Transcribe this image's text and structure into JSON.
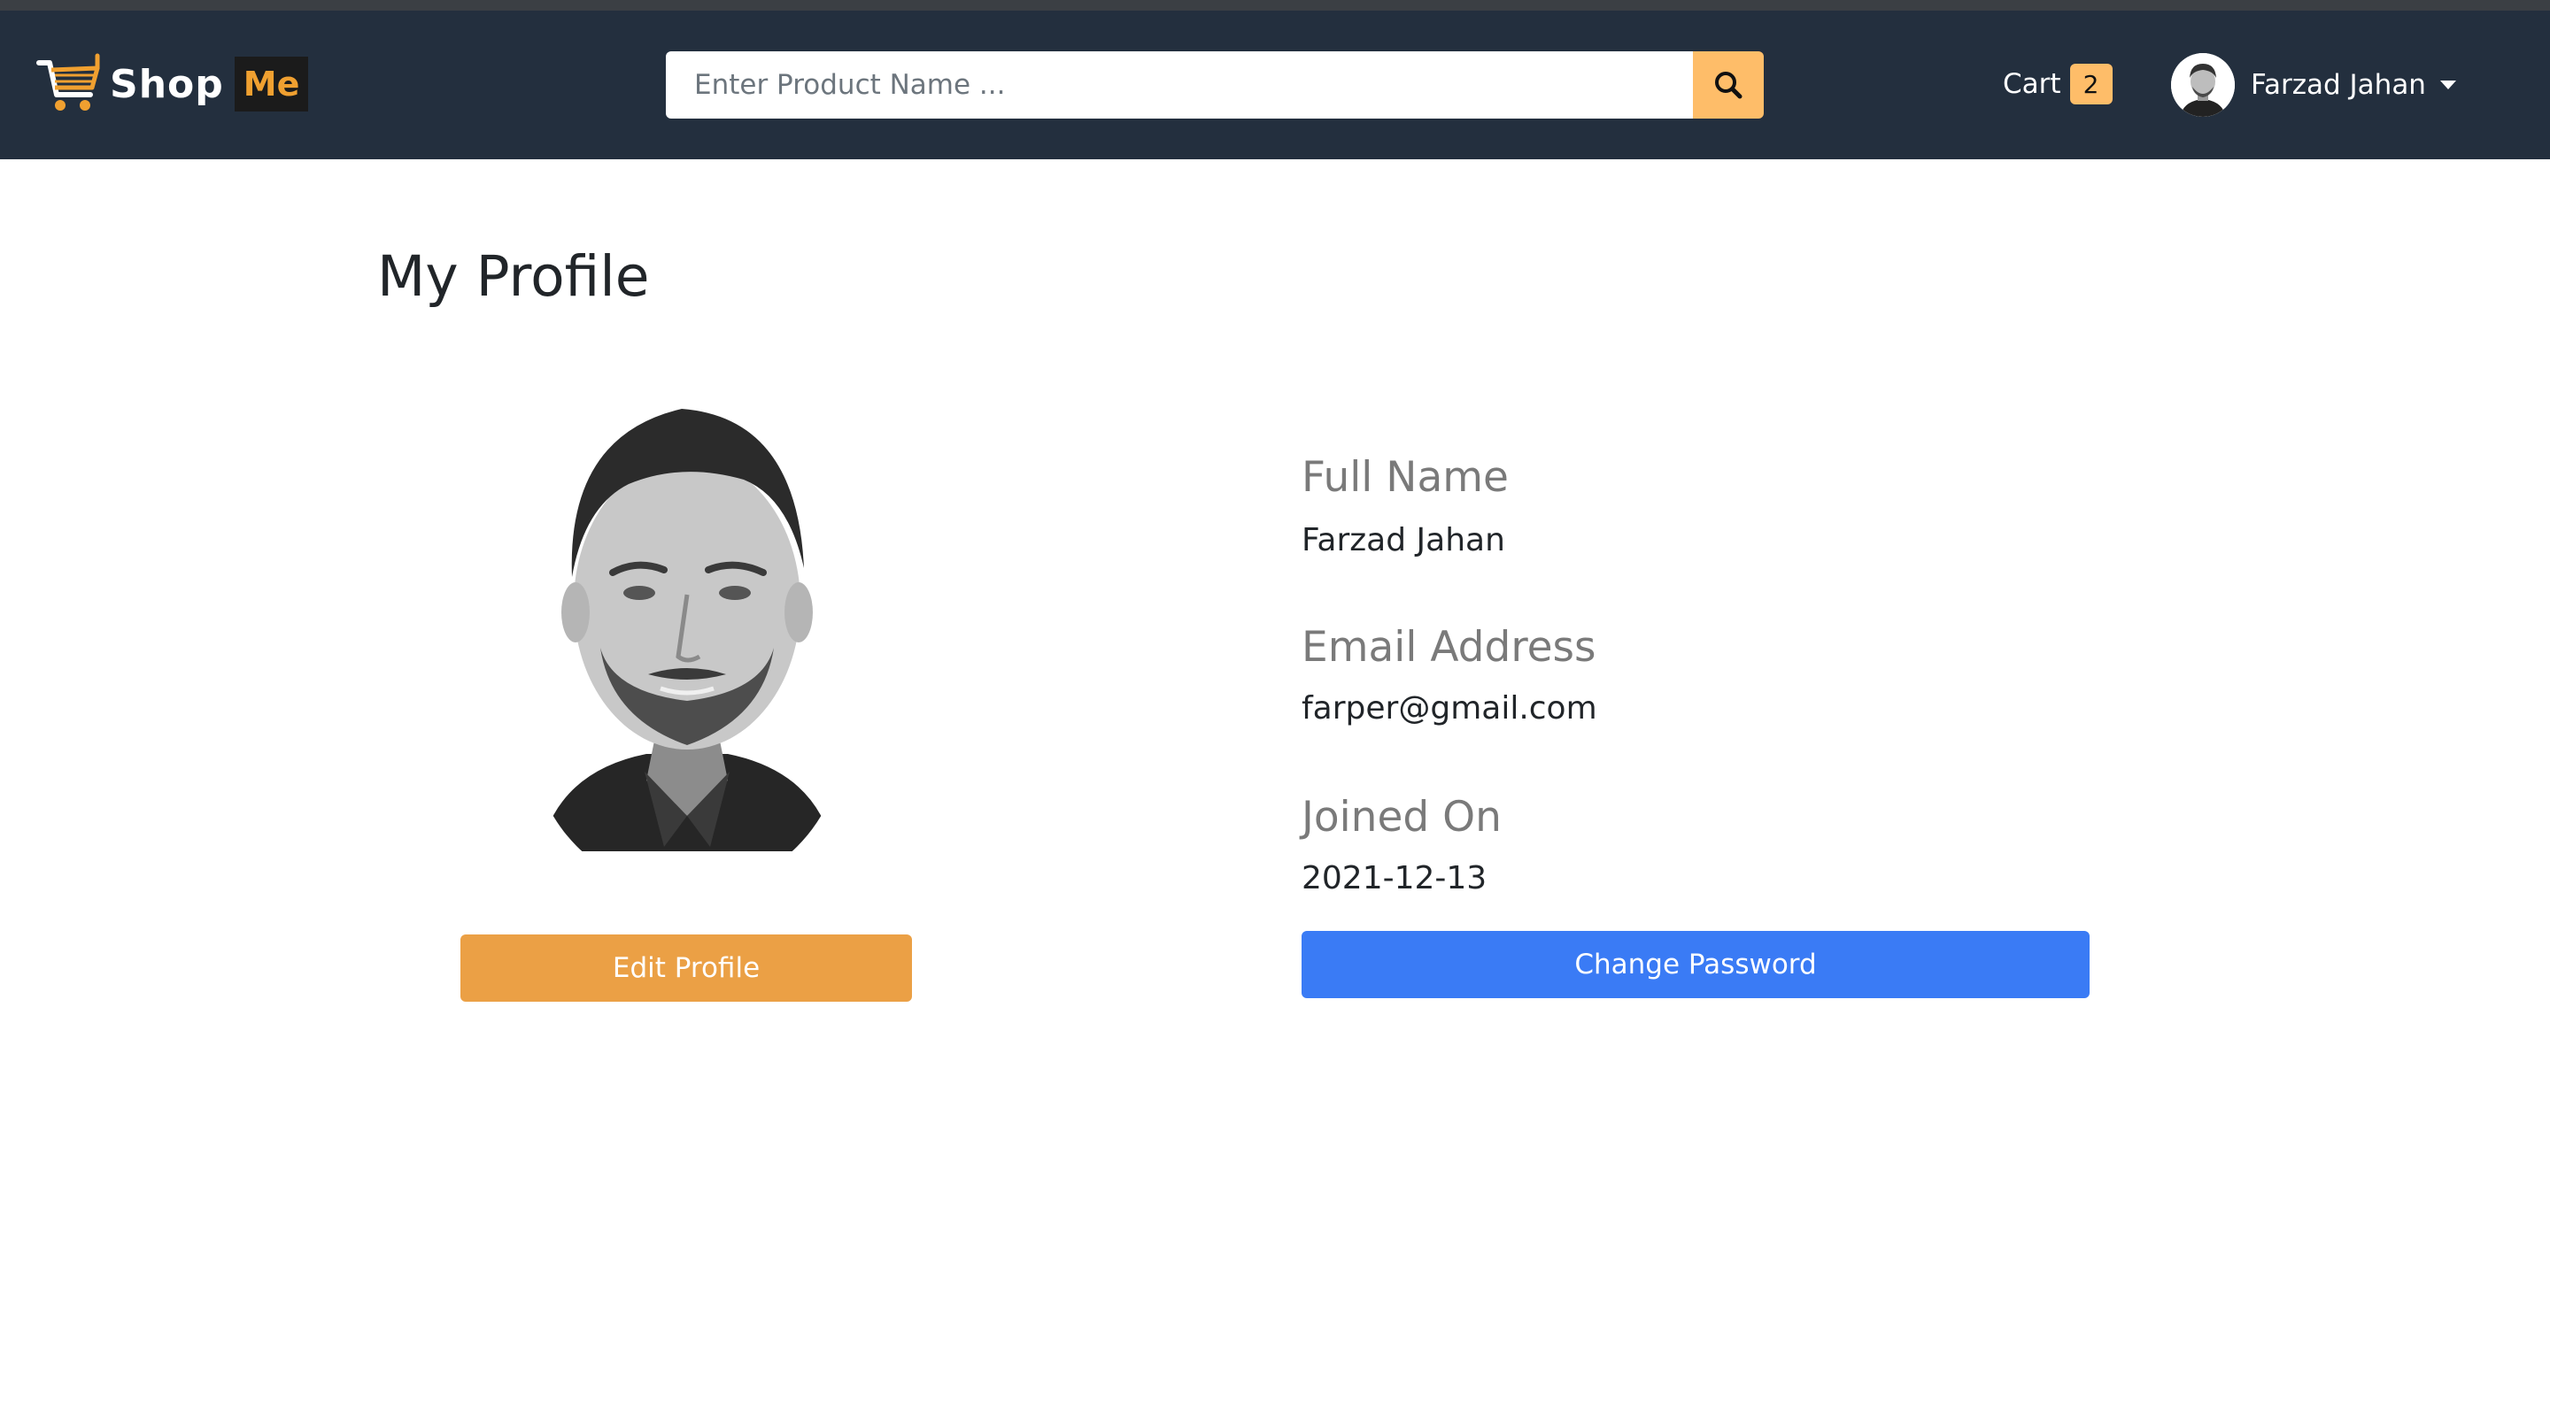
{
  "brand": {
    "shop": "Shop",
    "me": "Me"
  },
  "search": {
    "placeholder": "Enter Product Name ..."
  },
  "cart": {
    "label": "Cart",
    "count": "2"
  },
  "user": {
    "name": "Farzad Jahan"
  },
  "profile": {
    "title": "My Profile",
    "full_name_label": "Full Name",
    "full_name": "Farzad Jahan",
    "email_label": "Email Address",
    "email": "farper@gmail.com",
    "joined_label": "Joined On",
    "joined": "2021-12-13",
    "edit_button": "Edit Profile",
    "change_password_button": "Change Password"
  },
  "colors": {
    "navbar": "#232f3e",
    "accent": "#febd69",
    "edit_button": "#eba045",
    "primary_button": "#3a7bf5"
  },
  "icons": [
    "shopping-cart-logo-icon",
    "search-icon",
    "user-avatar",
    "caret-down-icon",
    "profile-photo"
  ]
}
